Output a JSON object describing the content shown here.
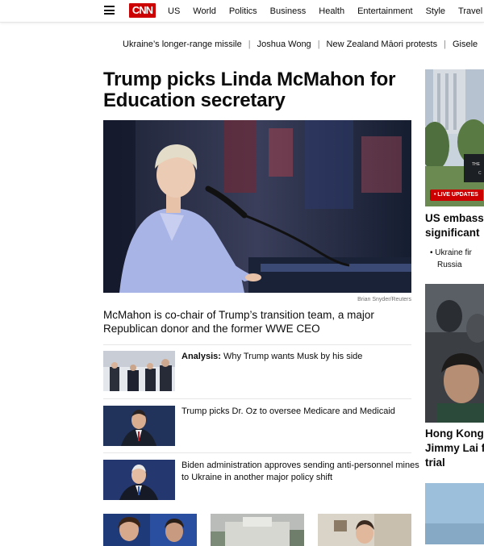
{
  "nav": {
    "logo": "CNN",
    "links": [
      "US",
      "World",
      "Politics",
      "Business",
      "Health",
      "Entertainment",
      "Style",
      "Travel"
    ]
  },
  "ticker": {
    "items": [
      "Ukraine’s longer-range missile",
      "Joshua Wong",
      "New Zealand Māori protests",
      "Gisele"
    ]
  },
  "lead": {
    "headline": "Trump picks Linda McMahon for Education secretary",
    "photo_credit": "Brian Snyder/Reuters",
    "subhead": "McMahon is co-chair of Trump’s transition team, a major Republican donor and the former WWE CEO"
  },
  "stories": [
    {
      "prefix": "Analysis:",
      "title": "Why Trump wants Musk by his side"
    },
    {
      "prefix": "",
      "title": "Trump picks Dr. Oz to oversee Medicare and Medicaid"
    },
    {
      "prefix": "",
      "title": "Biden administration approves sending anti-personnel mines to Ukraine in another major policy shift"
    }
  ],
  "right": {
    "live_badge": "• LIVE UPDATES",
    "story1_line1": "US embass",
    "story1_line2": "significant",
    "bullet_line1": "Ukraine fir",
    "bullet_line2": "Russia",
    "story2_line1": "Hong Kong",
    "story2_line2": "Jimmy Lai f",
    "story2_line3": "trial",
    "sign_line1": "THE",
    "sign_line2": "C"
  },
  "colors": {
    "brand": "#cc0000",
    "text": "#0c0c0c",
    "divider": "#e6e6e6",
    "hero_outfit": "#a9b4e6"
  }
}
